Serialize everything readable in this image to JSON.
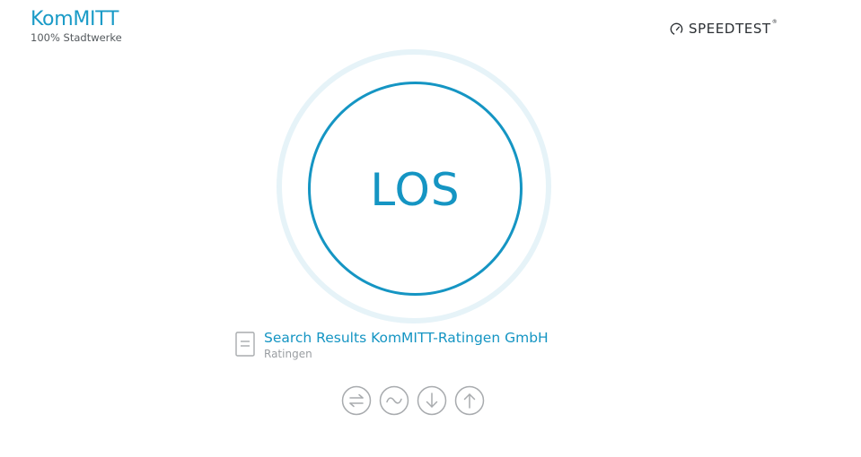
{
  "brand": {
    "name": "KomMITT",
    "tagline": "100% Stadtwerke"
  },
  "speedtest": {
    "label": "SPEEDTEST",
    "mark": "®",
    "icon": "speedometer-icon"
  },
  "start": {
    "label": "LOS"
  },
  "server": {
    "icon": "document-icon",
    "name": "Search Results KomMITT-Ratingen GmbH",
    "location": "Ratingen"
  },
  "metrics": [
    {
      "icon": "ping-icon"
    },
    {
      "icon": "jitter-icon"
    },
    {
      "icon": "download-icon"
    },
    {
      "icon": "upload-icon"
    }
  ],
  "colors": {
    "accent": "#1595c3",
    "brand": "#1a9bc7",
    "ring": "#e6f3f8",
    "muted": "#9a9ea2",
    "icon_gray": "#a8abae",
    "text_dark": "#2b2f33"
  }
}
